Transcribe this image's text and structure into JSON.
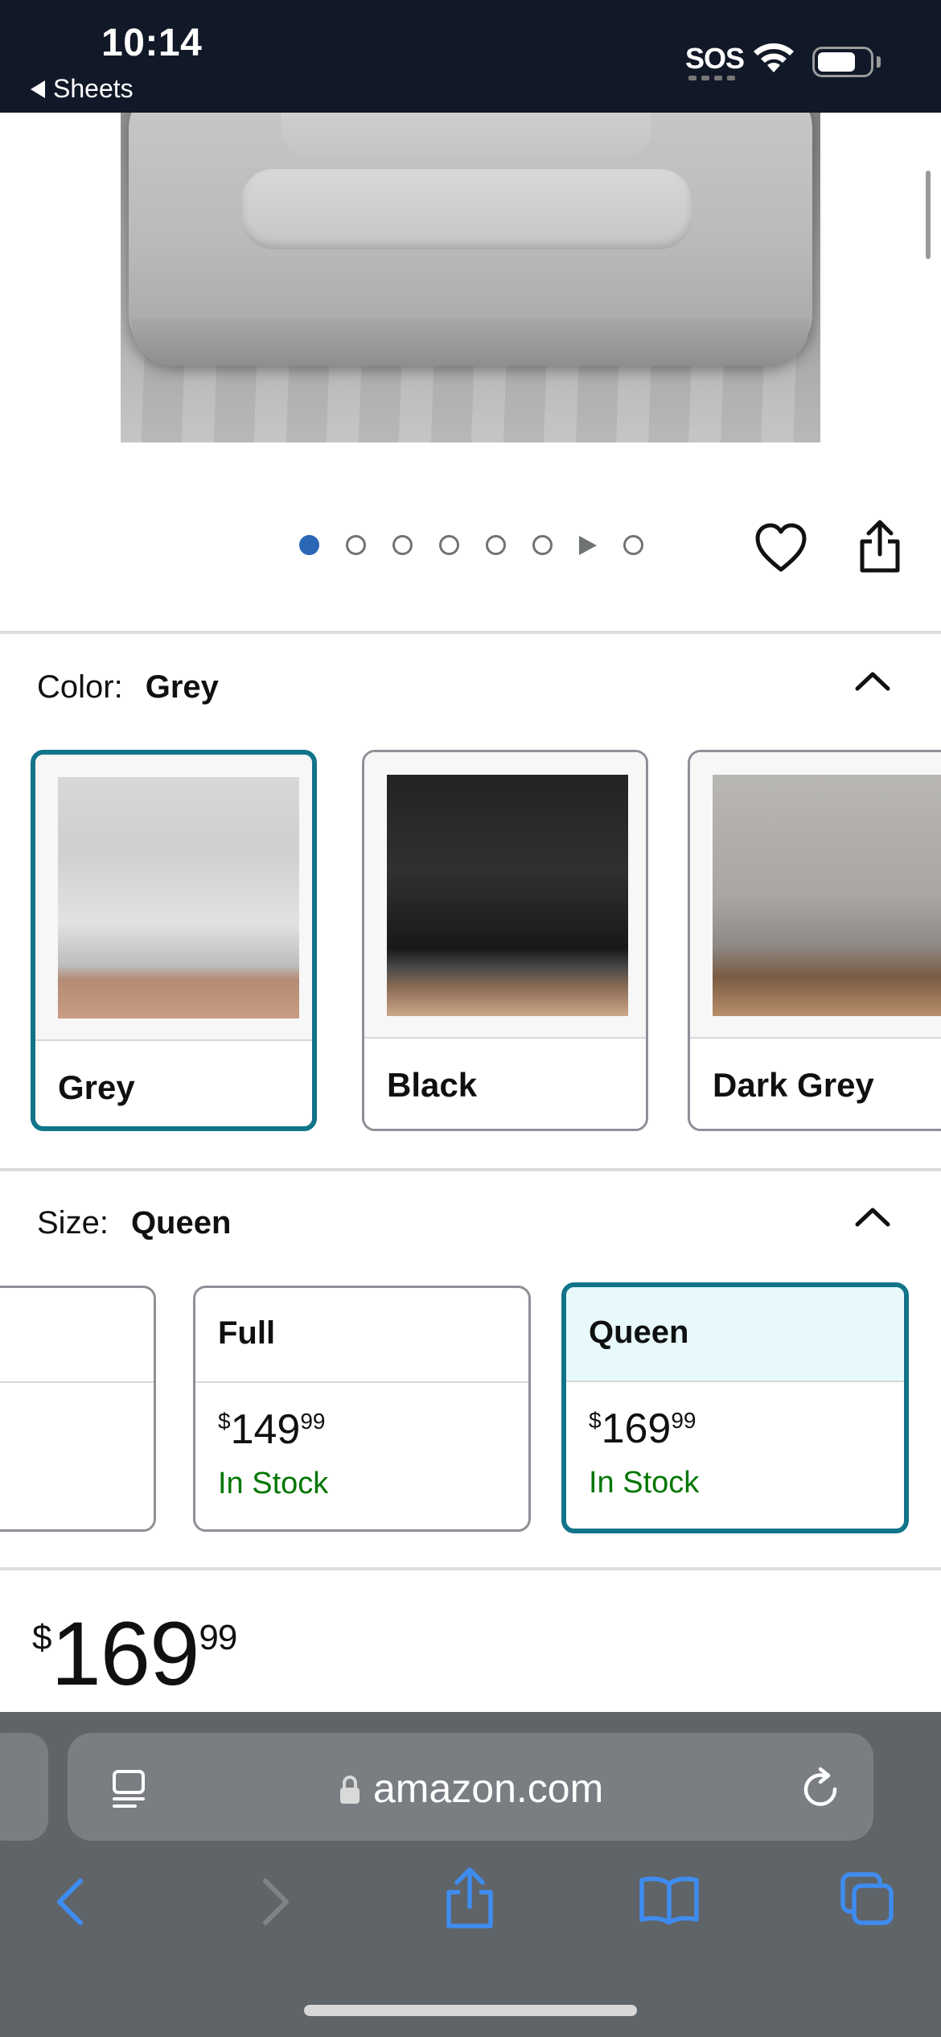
{
  "status_bar": {
    "time": "10:14",
    "back_app": "Sheets",
    "sos": "SOS"
  },
  "carousel": {
    "dots_total": 8,
    "active_index": 0,
    "video_dot_index": 6
  },
  "color_section": {
    "label": "Color:",
    "value": "Grey",
    "options": [
      {
        "name": "Grey",
        "selected": true
      },
      {
        "name": "Black",
        "selected": false
      },
      {
        "name": "Dark Grey",
        "selected": false
      }
    ]
  },
  "size_section": {
    "label": "Size:",
    "value": "Queen",
    "options": [
      {
        "name": "Full",
        "price_dollars": "149",
        "price_cents": "99",
        "currency": "$",
        "stock": "In Stock",
        "selected": false
      },
      {
        "name": "Queen",
        "price_dollars": "169",
        "price_cents": "99",
        "currency": "$",
        "stock": "In Stock",
        "selected": true
      }
    ]
  },
  "price": {
    "currency": "$",
    "dollars": "169",
    "cents": "99"
  },
  "browser": {
    "url": "amazon.com"
  },
  "icons": [
    "back-triangle-icon",
    "wifi-icon",
    "battery-icon",
    "heart-icon",
    "share-icon",
    "chevron-up-icon",
    "reader-icon",
    "lock-icon",
    "reload-icon",
    "back-arrow-icon",
    "forward-arrow-icon",
    "share-sheet-icon",
    "bookmarks-icon",
    "tabs-icon"
  ],
  "colors": {
    "selected_border": "#127489",
    "active_dot": "#2a68b5",
    "in_stock": "#007600",
    "toolbar_blue": "#3f8cf0"
  }
}
